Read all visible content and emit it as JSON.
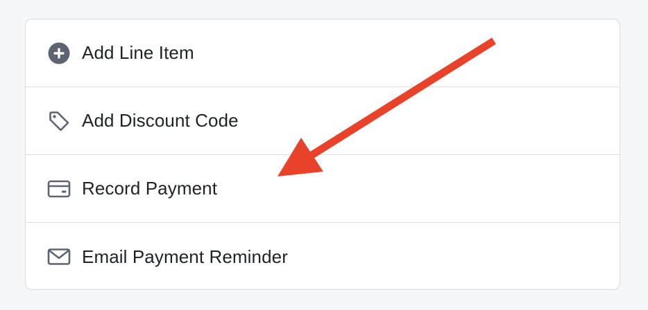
{
  "menu": {
    "items": [
      {
        "label": "Add Line Item",
        "icon": "plus-circle-icon"
      },
      {
        "label": "Add Discount Code",
        "icon": "tag-icon"
      },
      {
        "label": "Record Payment",
        "icon": "credit-card-icon"
      },
      {
        "label": "Email Payment Reminder",
        "icon": "envelope-icon"
      }
    ]
  },
  "colors": {
    "page_background": "#f6f7f9",
    "card_background": "#ffffff",
    "text": "#1f2328",
    "icon": "#5b6470",
    "annotation_arrow": "#e8432a"
  }
}
